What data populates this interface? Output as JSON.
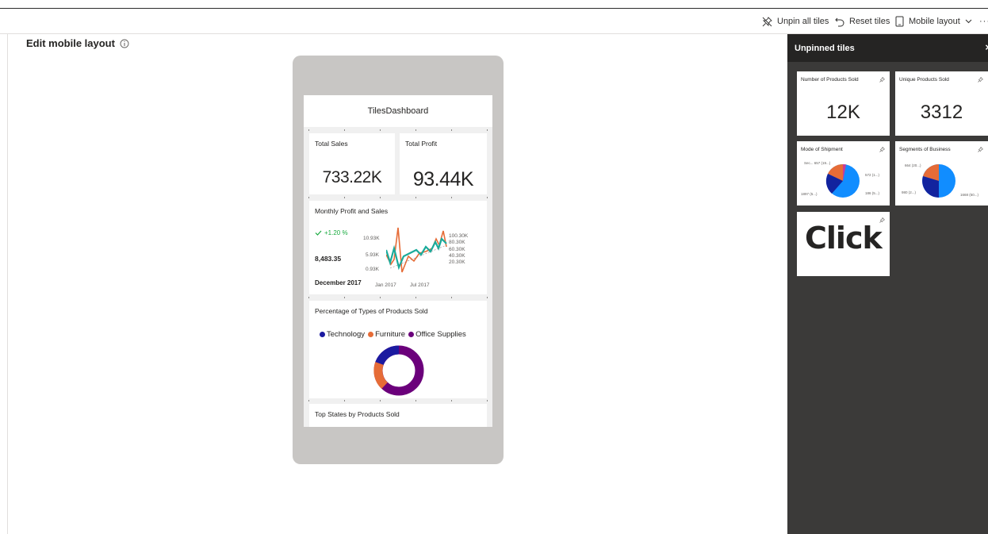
{
  "toolbar": {
    "unpin_all": "Unpin all tiles",
    "reset": "Reset tiles",
    "mobile_layout": "Mobile layout",
    "more": "···"
  },
  "page": {
    "title": "Edit mobile layout"
  },
  "dashboard": {
    "title": "TilesDashboard",
    "total_sales": {
      "title": "Total Sales",
      "value": "733.22K"
    },
    "total_profit": {
      "title": "Total Profit",
      "value": "93.44K"
    },
    "monthly": {
      "title": "Monthly Profit and Sales",
      "kpi_change": "+1.20 %",
      "kpi_value": "8,483.35",
      "kpi_period": "December 2017",
      "left_ticks": [
        "10.93K",
        "5.93K",
        "0.93K"
      ],
      "right_ticks": [
        "100.30K",
        "80.30K",
        "60.30K",
        "40.30K",
        "20.30K"
      ],
      "x_ticks": [
        "Jan 2017",
        "Jul 2017"
      ]
    },
    "percentage": {
      "title": "Percentage of Types of Products Sold",
      "legend": [
        {
          "label": "Technology",
          "color": "#1b1aa0"
        },
        {
          "label": "Furniture",
          "color": "#e66c37"
        },
        {
          "label": "Office Supplies",
          "color": "#6b007b"
        }
      ]
    },
    "top_states": {
      "title": "Top States by Products Sold"
    }
  },
  "panel": {
    "title": "Unpinned tiles",
    "close": "×",
    "tiles": {
      "number_sold": {
        "title": "Number of Products Sold",
        "value": "12K"
      },
      "unique_sold": {
        "title": "Unique Products Sold",
        "value": "3312"
      },
      "shipment": {
        "title": "Mode of Shipment",
        "labels": [
          "Sec... 657 (19...)",
          "572 (1...)",
          "1897 (5...)",
          "186 (5...)"
        ]
      },
      "segments": {
        "title": "Segments of Business",
        "labels": [
          "664 (20...)",
          "980 (2...)",
          "1668 (50...)"
        ]
      },
      "click": {
        "text": "Click"
      }
    }
  },
  "colors": {
    "accent_blue": "#118dff",
    "dark_blue": "#12239e",
    "orange": "#e66c37",
    "purple": "#6b007b",
    "teal": "#1aab9b",
    "green": "#1aab40"
  }
}
